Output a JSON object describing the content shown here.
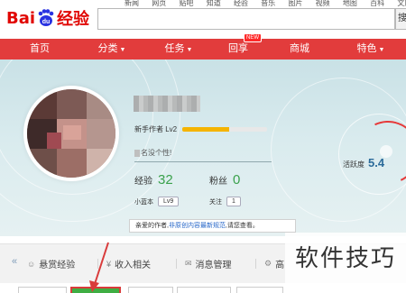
{
  "top_links": [
    "新闻",
    "网页",
    "贴吧",
    "知道",
    "经验",
    "音乐",
    "图片",
    "视频",
    "地图",
    "百科",
    "文库"
  ],
  "logo": {
    "text_left": "Bai",
    "text_paw": "du",
    "text_right": "经验"
  },
  "search": {
    "placeholder": "",
    "button_label": "搜"
  },
  "nav": {
    "items": [
      {
        "label": "首页",
        "caret": ""
      },
      {
        "label": "分类",
        "caret": "▼"
      },
      {
        "label": "任务",
        "caret": "▼"
      },
      {
        "label": "回享",
        "caret": "",
        "badge": "NEW"
      },
      {
        "label": "商城",
        "caret": ""
      },
      {
        "label": "特色",
        "caret": "▼"
      }
    ],
    "bg_color": "#e23c3c"
  },
  "profile": {
    "level_label": "新手作者 Lv2",
    "level_progress": 0.55,
    "signature": "名没个性!",
    "exp_label": "经验",
    "exp_value": "32",
    "fans_label": "粉丝",
    "fans_value": "0",
    "blue_label": "小蓝本",
    "blue_value": "Lv9",
    "follow_label": "关注",
    "follow_value": "1",
    "activity_label": "活跃度",
    "activity_value": "5.4"
  },
  "notice": {
    "prefix": "亲爱的作者,",
    "link": "非原创内容最新规范",
    "suffix": ",请您查看。"
  },
  "tabs": {
    "collapse_icon": "«",
    "items": [
      {
        "icon": "☺",
        "label": "悬赏经验"
      },
      {
        "icon": "¥",
        "label": "收入相关"
      },
      {
        "icon": "✉",
        "label": "消息管理"
      },
      {
        "icon": "⚙",
        "label": "高"
      }
    ]
  },
  "watermark": "软件技巧",
  "colors": {
    "accent_green": "#3aa14c",
    "progress_yellow": "#f5b400",
    "annotation_red": "#d93b3b"
  }
}
